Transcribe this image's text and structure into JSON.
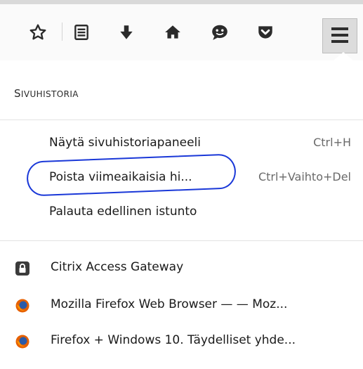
{
  "toolbar": {
    "buttons": [
      {
        "name": "bookmark-star-icon"
      },
      {
        "name": "reading-list-icon"
      },
      {
        "name": "downloads-icon"
      },
      {
        "name": "home-icon"
      },
      {
        "name": "chat-icon"
      },
      {
        "name": "pocket-icon"
      }
    ],
    "menu_icon": "hamburger-menu-icon"
  },
  "panel": {
    "title_first": "S",
    "title_rest": "IVUHISTORIA",
    "items": [
      {
        "label": "Näytä sivuhistoriapaneeli",
        "shortcut": "Ctrl+H"
      },
      {
        "label": "Poista viimeaikaisia hi...",
        "shortcut": "Ctrl+Vaihto+Del"
      },
      {
        "label": "Palauta edellinen istunto",
        "shortcut": ""
      }
    ],
    "history": [
      {
        "label": "Citrix Access Gateway",
        "icon": "lock-icon"
      },
      {
        "label": "Mozilla Firefox Web Browser — — Moz...",
        "icon": "firefox-icon"
      },
      {
        "label": "Firefox + Windows 10. Täydelliset yhde...",
        "icon": "firefox-icon"
      }
    ],
    "annotation_color": "#1a38d8"
  }
}
